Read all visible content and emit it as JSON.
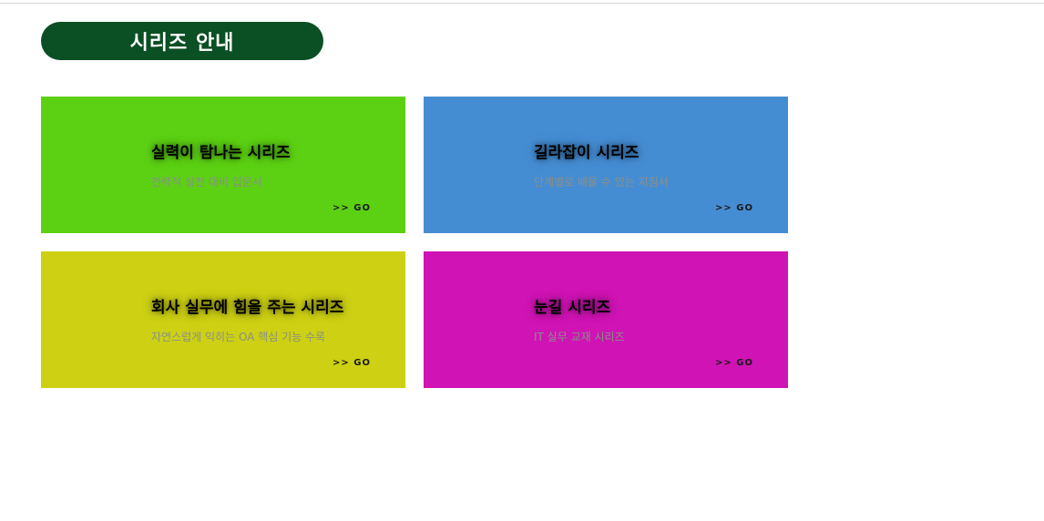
{
  "header": {
    "title": "시리즈 안내",
    "pill_color": "#0b4f24"
  },
  "cards": [
    {
      "title": "실력이 탐나는 시리즈",
      "description": "전략적 실전 대비 입문서",
      "go": ">> GO",
      "bg_color": "#5cd113"
    },
    {
      "title": "길라잡이 시리즈",
      "description": "단계별로 배울 수 있는 지침서",
      "go": ">> GO",
      "bg_color": "#458dd3"
    },
    {
      "title": "회사 실무에 힘을 주는 시리즈",
      "description": "자연스럽게 익히는 OA 핵심 기능 수록",
      "go": ">> GO",
      "bg_color": "#cdd013"
    },
    {
      "title": "눈길 시리즈",
      "description": "IT 실무 교재 시리즈",
      "go": ">> GO",
      "bg_color": "#cf13b4"
    }
  ]
}
